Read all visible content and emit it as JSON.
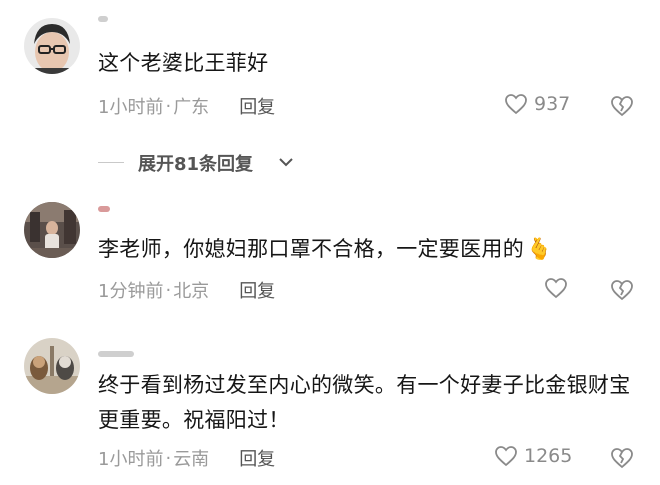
{
  "comments": [
    {
      "text": "这个老婆比王菲好",
      "time": "1小时前",
      "location": "广东",
      "reply_label": "回复",
      "likes": "937"
    },
    {
      "text": "李老师，你媳妇那口罩不合格，一定要医用的",
      "emoji": "🫰",
      "time": "1分钟前",
      "location": "北京",
      "reply_label": "回复",
      "likes": ""
    },
    {
      "text": "终于看到杨过发至内心的微笑。有一个好妻子比金银财宝更重要。祝福阳过！",
      "time": "1小时前",
      "location": "云南",
      "reply_label": "回复",
      "likes": "1265"
    }
  ],
  "expand_replies": {
    "label": "展开81条回复"
  },
  "meta_separator": "·",
  "icons": {
    "like": "heart-outline-icon",
    "dislike": "broken-heart-icon",
    "expand": "chevron-down-icon"
  },
  "colors": {
    "text": "#161616",
    "meta": "#9a9a9a",
    "icon": "#8a8a8a"
  }
}
